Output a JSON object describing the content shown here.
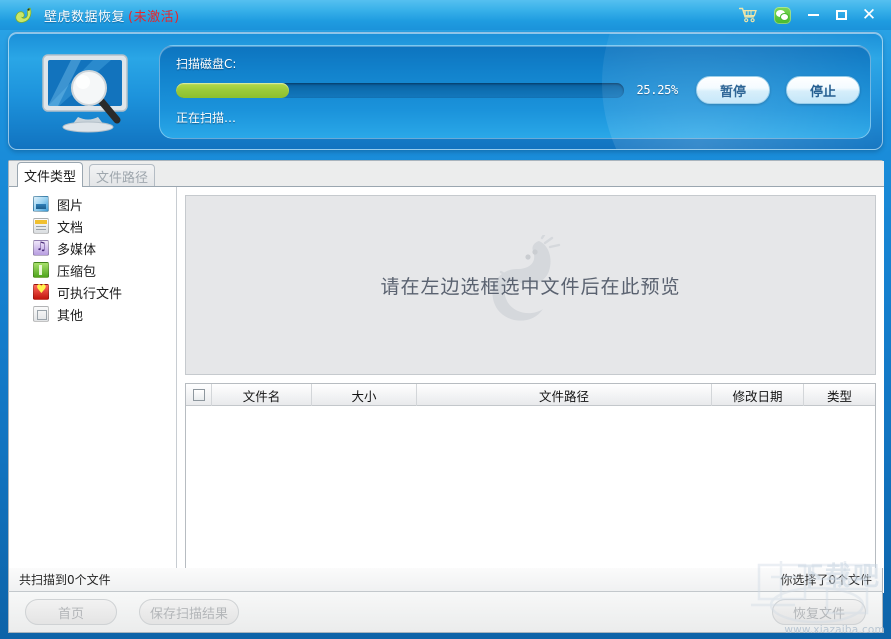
{
  "window": {
    "title": "壁虎数据恢复",
    "status_suffix": "(未激活)",
    "logo_icon": "gecko-logo-icon",
    "controls": {
      "cart": "cart-icon",
      "wechat": "wechat-icon",
      "minimize": "minimize-button",
      "maximize": "maximize-button",
      "close": "close-button",
      "close_glyph": "✕"
    }
  },
  "scan": {
    "art_icon": "monitor-magnifier-icon",
    "disk_label": "扫描磁盘C:",
    "progress_percent_text": "25.25%",
    "progress_value": 25.25,
    "status_text": "正在扫描…",
    "pause_button": "暂停",
    "stop_button": "停止",
    "fill_color": "#9ccb3a",
    "track_color": "#0e6fb3"
  },
  "tabs": [
    {
      "label": "文件类型",
      "active": true
    },
    {
      "label": "文件路径",
      "active": false
    }
  ],
  "tree": {
    "items": [
      {
        "label": "图片",
        "icon": "image-file-icon"
      },
      {
        "label": "文档",
        "icon": "document-file-icon"
      },
      {
        "label": "多媒体",
        "icon": "media-file-icon"
      },
      {
        "label": "压缩包",
        "icon": "archive-file-icon"
      },
      {
        "label": "可执行文件",
        "icon": "executable-file-icon"
      },
      {
        "label": "其他",
        "icon": "other-file-icon"
      }
    ]
  },
  "preview": {
    "placeholder_text": "请在左边选框选中文件后在此预览",
    "background_icon": "gecko-watermark-icon"
  },
  "file_list": {
    "columns": [
      "文件名",
      "大小",
      "文件路径",
      "修改日期",
      "类型"
    ],
    "select_all_checkbox": "select-all-checkbox",
    "rows": []
  },
  "status_bar": {
    "scanned_text": "共扫描到0个文件",
    "selected_text": "你选择了0个文件"
  },
  "bottom_bar": {
    "home_button": "首页",
    "save_button": "保存扫描结果",
    "recover_button": "恢复文件"
  },
  "watermark": {
    "brand": "下载吧",
    "url": "www.xiazaiba.com"
  }
}
